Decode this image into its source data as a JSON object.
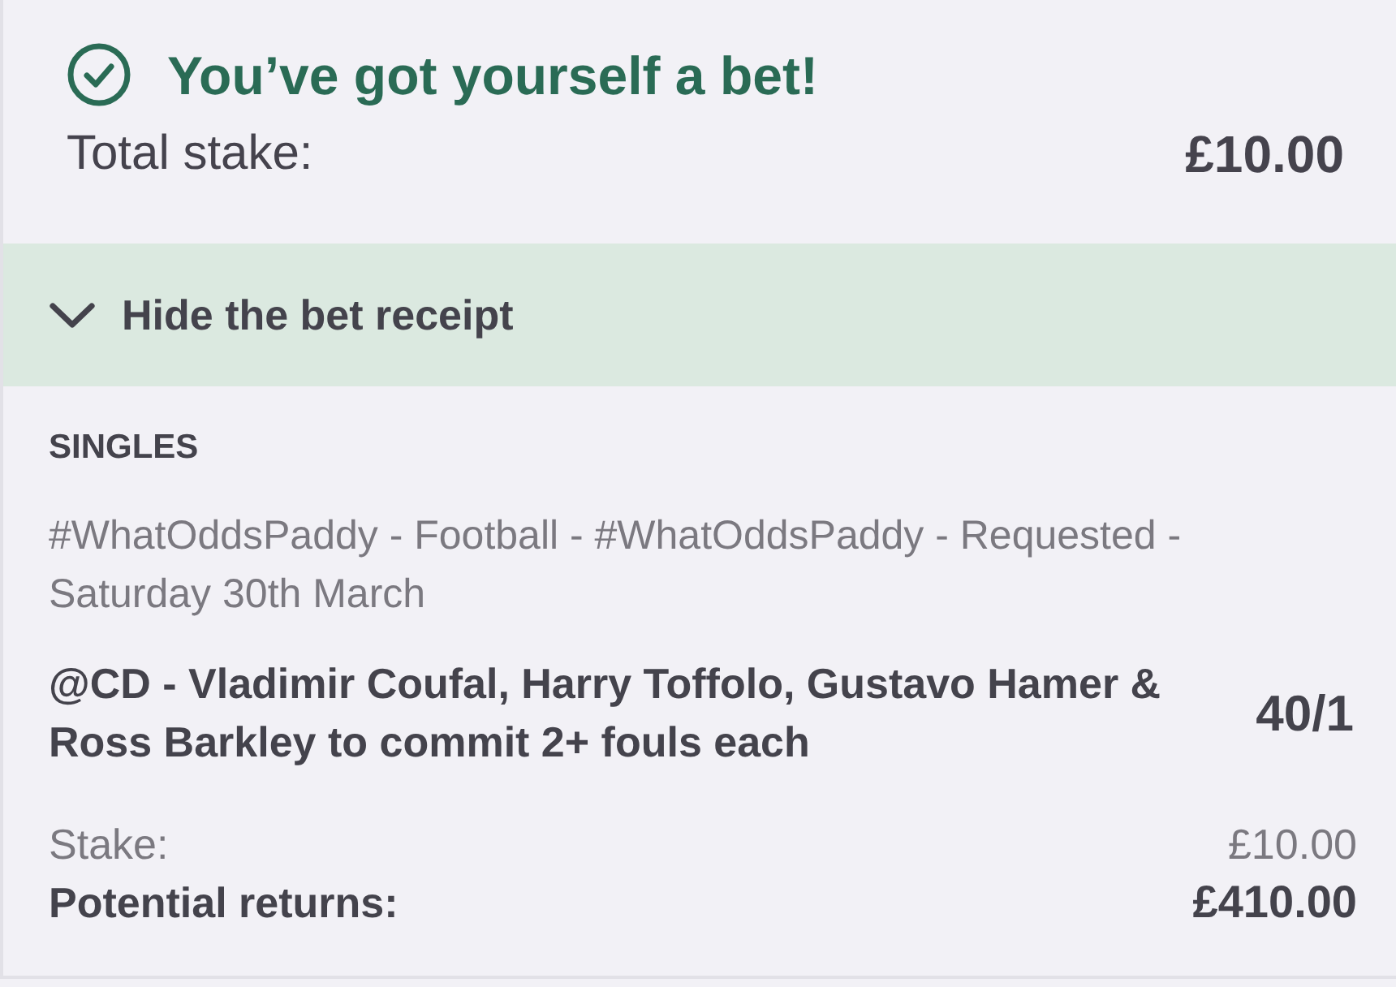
{
  "confirmation": {
    "title": "You’ve got yourself a bet!",
    "total_stake_label": "Total stake:",
    "total_stake": "£10.00"
  },
  "receipt_toggle": {
    "label": "Hide the bet receipt",
    "expanded": true
  },
  "receipt": {
    "section_title": "SINGLES",
    "bets": [
      {
        "event": "#WhatOddsPaddy - Football - #WhatOddsPaddy - Requested - Saturday 30th March",
        "selection": "@CD - Vladimir Coufal, Harry Toffolo, Gustavo Hamer & Ross Barkley to commit 2+ fouls each",
        "odds": "40/1",
        "stake_label": "Stake:",
        "stake": "£10.00",
        "returns_label": "Potential returns:",
        "returns": "£410.00"
      }
    ]
  }
}
